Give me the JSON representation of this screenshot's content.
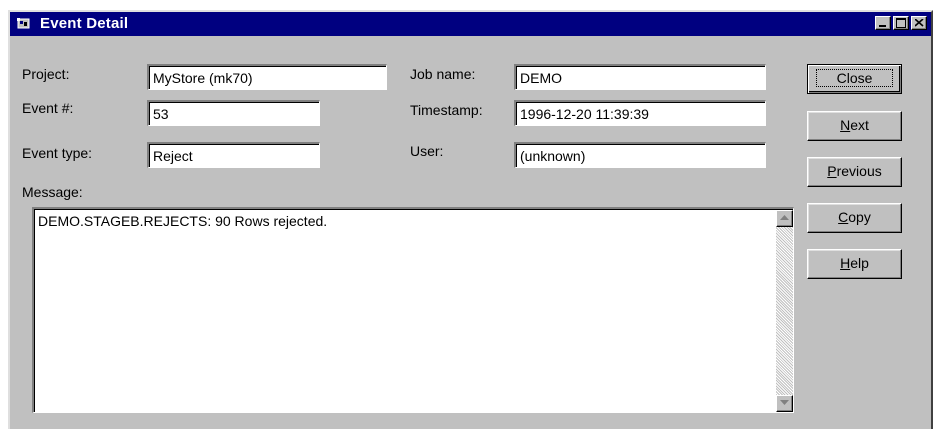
{
  "window": {
    "title": "Event Detail",
    "icon": "event-app-icon"
  },
  "fields": {
    "project": {
      "label": "Project:",
      "value": "MyStore (mk70)"
    },
    "event_number": {
      "label": "Event #:",
      "value": "53"
    },
    "event_type": {
      "label": "Event type:",
      "value": "Reject"
    },
    "job_name": {
      "label": "Job name:",
      "value": "DEMO"
    },
    "timestamp": {
      "label": "Timestamp:",
      "value": "1996-12-20 11:39:39"
    },
    "user": {
      "label": "User:",
      "value": "(unknown)"
    }
  },
  "message": {
    "label": "Message:",
    "text": "DEMO.STAGEB.REJECTS: 90 Rows rejected."
  },
  "buttons": {
    "close": {
      "label": "Close"
    },
    "next": {
      "mnemonic": "N",
      "rest": "ext"
    },
    "previous": {
      "mnemonic": "P",
      "rest": "revious"
    },
    "copy": {
      "mnemonic": "C",
      "rest": "opy"
    },
    "help": {
      "mnemonic": "H",
      "rest": "elp"
    }
  },
  "colors": {
    "titlebar": "#000080",
    "face": "#c0c0c0",
    "field_bg": "#ffffff"
  }
}
